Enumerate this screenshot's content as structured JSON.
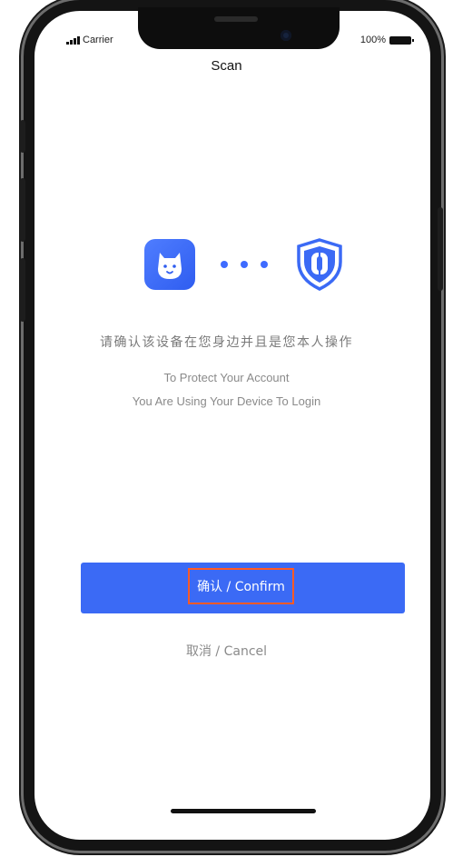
{
  "status_bar": {
    "carrier": "Carrier",
    "battery": "100%"
  },
  "header": {
    "title": "Scan"
  },
  "icons": {
    "app": "dog-face-icon",
    "dots": "ellipsis-dots-icon",
    "security": "shield-icon"
  },
  "content": {
    "cn_text": "请确认该设备在您身边并且是您本人操作",
    "en_line1": "To Protect Your Account",
    "en_line2": "You Are Using Your Device To Login"
  },
  "actions": {
    "confirm_label": "确认 / Confirm",
    "cancel_label": "取消 / Cancel"
  },
  "colors": {
    "accent": "#3b6af5",
    "highlight_border": "#ff5a26"
  }
}
